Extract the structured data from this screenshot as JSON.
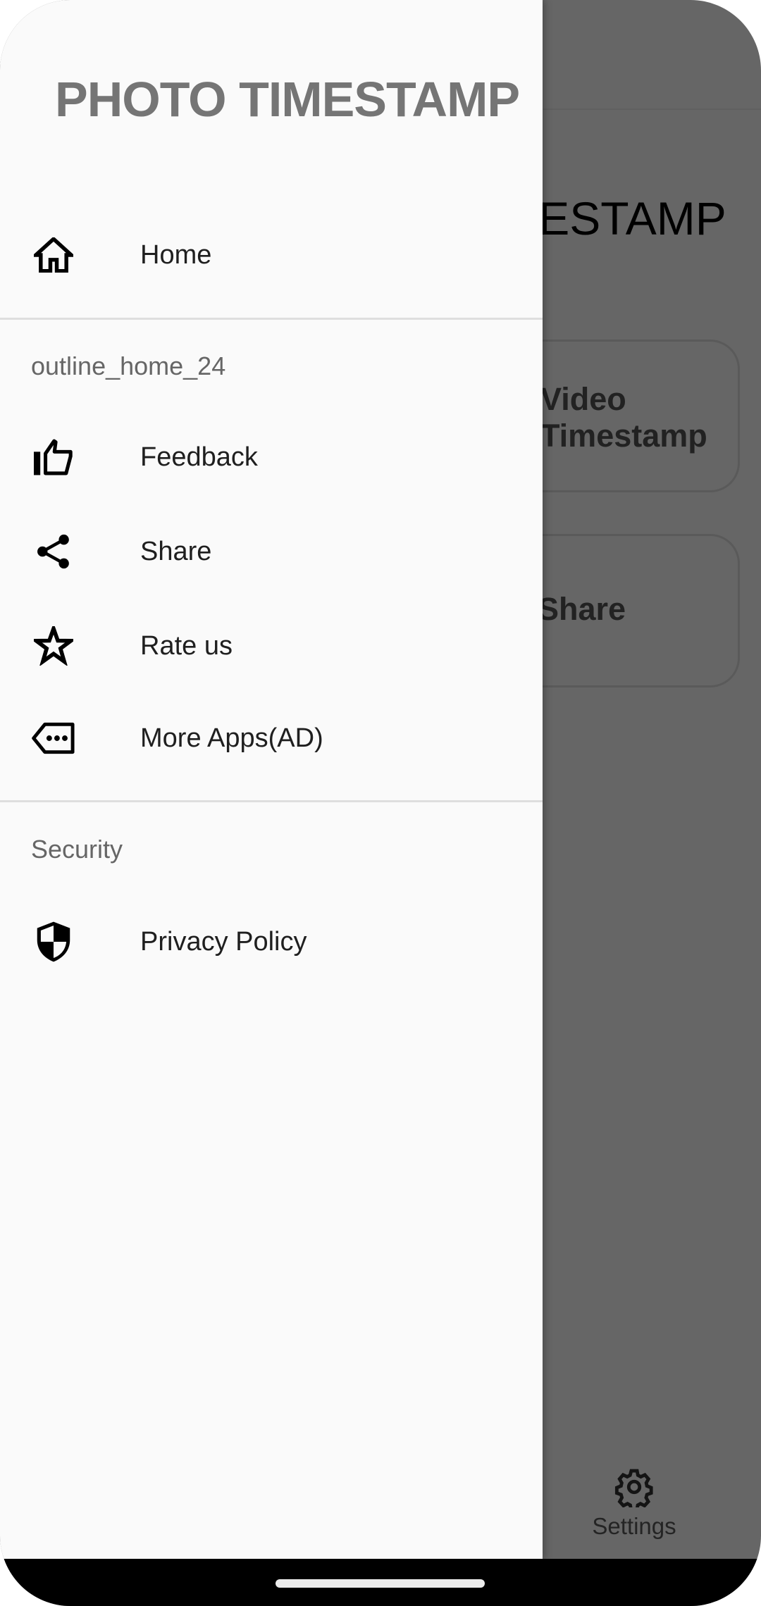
{
  "app": {
    "heading_fragment": "PHOTO TIMESTAMP",
    "cards": [
      {
        "label_line1": "Video",
        "label_line2": "Timestamp"
      },
      {
        "label": "Share"
      }
    ],
    "bottom_nav": {
      "settings_label": "Settings",
      "settings_icon": "gear-icon"
    }
  },
  "drawer": {
    "title": "PHOTO TIMESTAMP",
    "top_items": [
      {
        "label": "Home",
        "icon": "home-icon"
      }
    ],
    "section1": {
      "header": "outline_home_24",
      "items": [
        {
          "label": "Feedback",
          "icon": "thumb-up-icon"
        },
        {
          "label": "Share",
          "icon": "share-icon"
        },
        {
          "label": "Rate us",
          "icon": "star-icon"
        },
        {
          "label": "More Apps(AD)",
          "icon": "more-apps-tag-icon"
        }
      ]
    },
    "section2": {
      "header": "Security",
      "items": [
        {
          "label": "Privacy Policy",
          "icon": "shield-icon"
        }
      ]
    }
  },
  "colors": {
    "drawer_bg": "#fafafa",
    "title": "#757575",
    "subheader": "#666666",
    "item_text": "#1f1f1f",
    "scrim": "#666666"
  }
}
